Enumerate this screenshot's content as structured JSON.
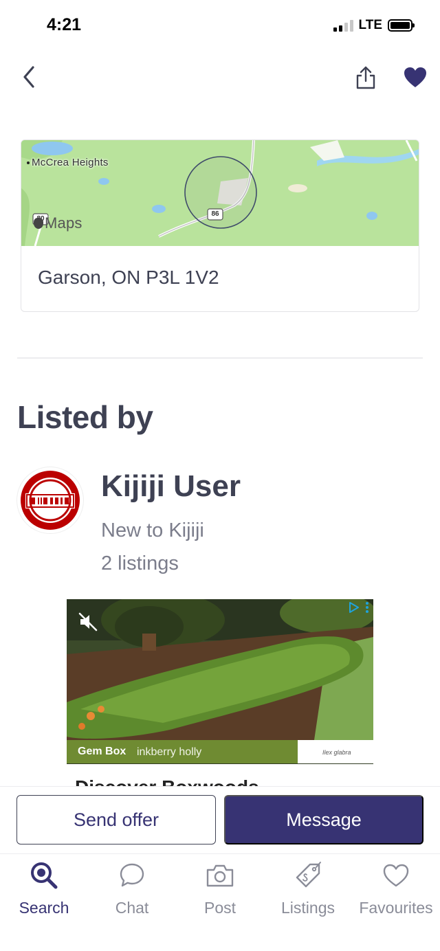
{
  "status_bar": {
    "time": "4:21",
    "network": "LTE"
  },
  "nav": {
    "back_icon": "chevron-left-icon",
    "share_icon": "share-icon",
    "favourite_icon": "heart-filled-icon",
    "accent_color": "#373373"
  },
  "map": {
    "place_label": "McCrea Heights",
    "provider_label": "Maps",
    "highway_shields": [
      "80",
      "86"
    ],
    "address": "Garson, ON P3L 1V2"
  },
  "listed_by": {
    "title": "Listed by",
    "seller": {
      "name": "Kijiji User",
      "status": "New to Kijiji",
      "listings": "2 listings",
      "avatar_icon": "ohio-state-logo"
    }
  },
  "ad": {
    "caption_brand": "Gem Box",
    "caption_product": "inkberry holly",
    "caption_latin": "Ilex glabra",
    "headline": "Discover Boxwoods",
    "mute_icon": "speaker-muted-icon",
    "choices_icon": "ad-choices-icon"
  },
  "actions": {
    "offer_label": "Send offer",
    "message_label": "Message"
  },
  "tabs": [
    {
      "label": "Search",
      "icon": "search-icon",
      "active": true
    },
    {
      "label": "Chat",
      "icon": "chat-icon",
      "active": false
    },
    {
      "label": "Post",
      "icon": "camera-icon",
      "active": false
    },
    {
      "label": "Listings",
      "icon": "tag-icon",
      "active": false
    },
    {
      "label": "Favourites",
      "icon": "heart-outline-icon",
      "active": false
    }
  ]
}
